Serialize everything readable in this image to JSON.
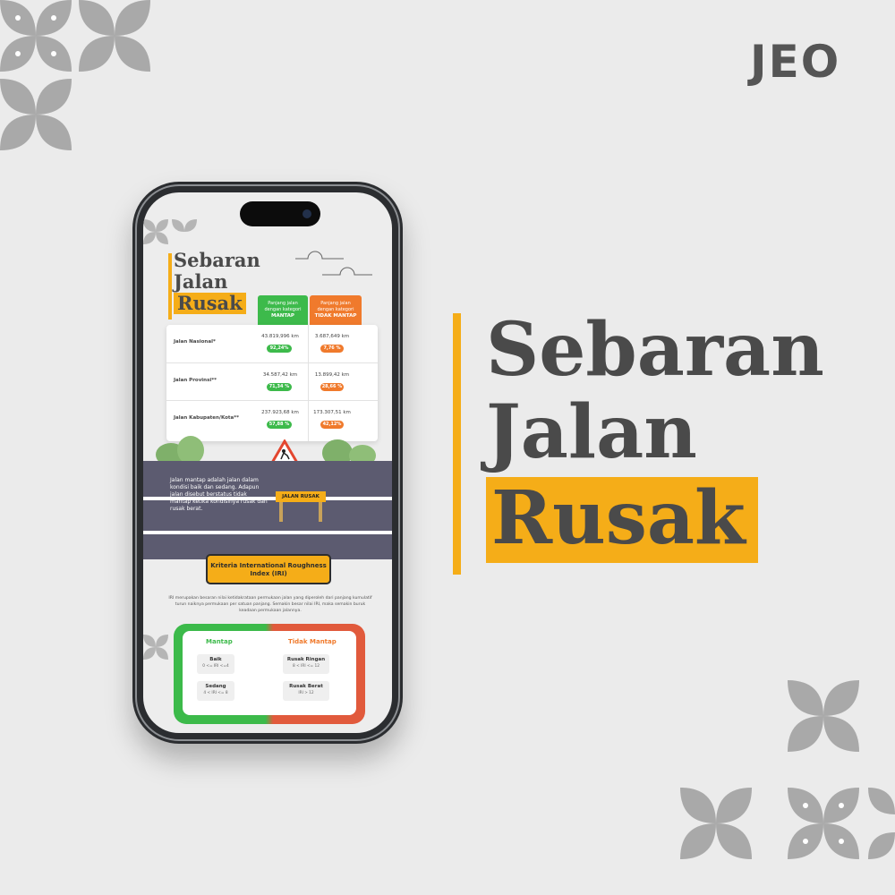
{
  "brand": {
    "logo_text": "JEO"
  },
  "headline": {
    "line1": "Sebaran",
    "line2": "Jalan",
    "line3_highlight": "Rusak"
  },
  "colors": {
    "accent": "#f5ad18",
    "green": "#3dba4b",
    "orange": "#f07a2c",
    "text": "#4a4a4a",
    "background": "#ebebeb"
  },
  "phone_screen": {
    "title": {
      "line1": "Sebaran",
      "line2": "Jalan",
      "line3_highlight": "Rusak"
    },
    "table": {
      "col_mantap": {
        "line1": "Panjang jalan",
        "line2": "dengan kategori",
        "tag": "MANTAP"
      },
      "col_tidak": {
        "line1": "Panjang jalan",
        "line2": "dengan kategori",
        "tag": "TIDAK MANTAP"
      },
      "rows": [
        {
          "label": "Jalan Nasional*",
          "mantap_km": "43.819,996 km",
          "mantap_pct": "92,24%",
          "tidak_km": "3.687,649 km",
          "tidak_pct": "7,76 %"
        },
        {
          "label": "Jalan Provinsi**",
          "mantap_km": "34.587,42 km",
          "mantap_pct": "71,34 %",
          "tidak_km": "13.899,42 km",
          "tidak_pct": "28,66 %"
        },
        {
          "label": "Jalan Kabupaten/Kota**",
          "mantap_km": "237.923,68 km",
          "mantap_pct": "57,88 %",
          "tidak_km": "173.307,51 km",
          "tidak_pct": "42,12%"
        }
      ]
    },
    "road": {
      "description": "Jalan mantap adalah jalan dalam kondisi baik dan sedang. Adapun jalan disebut berstatus tidak mantap ketika kondisinya rusak dan rusak berat.",
      "sign": "JALAN RUSAK"
    },
    "iri": {
      "button": "Kriteria International Roughness Index (IRI)",
      "text": "IRI merupakan besaran nilai ketidakrataan permukaan jalan yang diperoleh dari panjang kumulatif turun naiknya permukaan per satuan panjang. Semakin besar nilai IRI, maka semakin buruk keadaan permukaan jalannya."
    },
    "criteria": {
      "mantap_label": "Mantap",
      "tidak_label": "Tidak Mantap",
      "baik": {
        "label": "Baik",
        "range": "0 <= IRI <=4"
      },
      "sedang": {
        "label": "Sedang",
        "range": "4 < IRI <= 8"
      },
      "ringan": {
        "label": "Rusak Ringan",
        "range": "8 < IRI <= 12"
      },
      "berat": {
        "label": "Rusak Berat",
        "range": "IRI > 12"
      }
    }
  },
  "icons": [
    "flower-pattern-icon",
    "cloud-icon",
    "bush-icon",
    "roadwork-sign-icon"
  ]
}
